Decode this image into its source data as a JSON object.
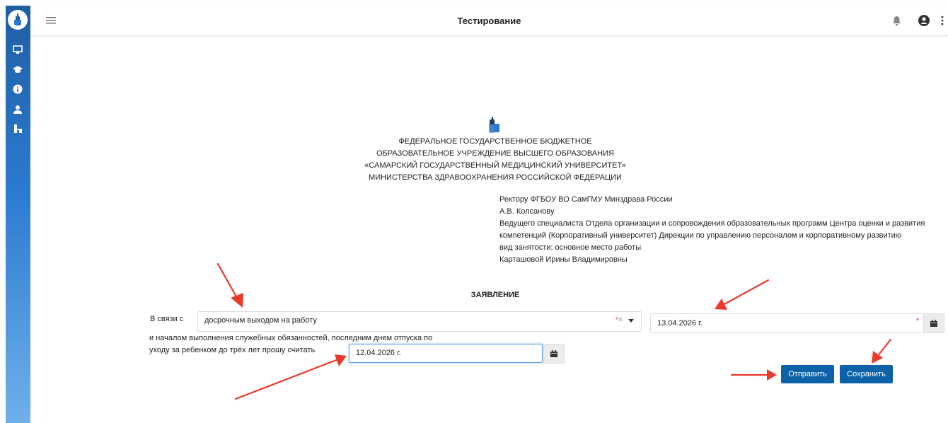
{
  "header": {
    "title": "Тестирование"
  },
  "sidebar": {
    "icons": [
      "university-logo-icon",
      "monitor-icon",
      "graduation-cap-icon",
      "info-icon",
      "user-icon",
      "structure-icon"
    ]
  },
  "org": {
    "lines": [
      "ФЕДЕРАЛЬНОЕ ГОСУДАРСТВЕННОЕ БЮДЖЕТНОЕ",
      "ОБРАЗОВАТЕЛЬНОЕ УЧРЕЖДЕНИЕ ВЫСШЕГО ОБРАЗОВАНИЯ",
      "«САМАРСКИЙ ГОСУДАРСТВЕННЫЙ МЕДИЦИНСКИЙ УНИВЕРСИТЕТ»",
      "МИНИСТЕРСТВА ЗДРАВООХРАНЕНИЯ РОССИЙСКОЙ ФЕДЕРАЦИИ"
    ]
  },
  "addressee": {
    "lines": [
      "Ректору ФГБОУ ВО СамГМУ Минздрава России",
      "А.В. Колсанову",
      "Ведущего специалиста Отдела организации и сопровождения образовательных программ Центра оценки и развития компетенций (Корпоративный университет) Дирекции по управлению персоналом и корпоративному развитию",
      "вид занятости: основное место работы",
      "Карташовой Ирины Владимировны"
    ]
  },
  "statement": {
    "heading": "ЗАЯВЛЕНИЕ",
    "reason_label": "В связи с",
    "reason_value": "досрочным выходом на работу",
    "clear_symbol": "×",
    "required_mark": "*",
    "start_date": "13.04.2026 г.",
    "text": "и началом выполнения служебных обязанностей, последним днем отпуска по уходу за ребенком до трёх лет прошу считать",
    "last_day_date": "12.04.2026 г."
  },
  "actions": {
    "send_label": "Отправить",
    "save_label": "Сохранить"
  },
  "colors": {
    "sidebar": "#1f5fa4",
    "button": "#0b62a8",
    "annotation_arrow": "#e8392b",
    "required": "#e33333"
  }
}
